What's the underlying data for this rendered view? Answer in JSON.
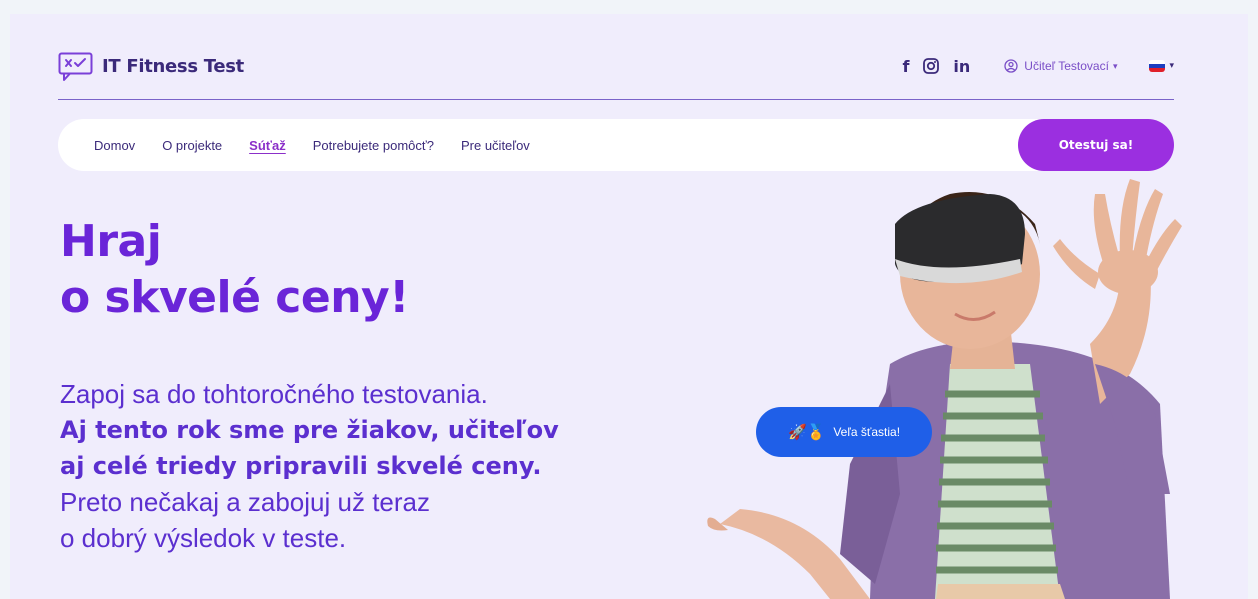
{
  "brand": {
    "name": "IT Fitness Test"
  },
  "social": [
    {
      "label": "f",
      "icon": "facebook-icon"
    },
    {
      "label": "◎",
      "icon": "instagram-icon"
    },
    {
      "label": "in",
      "icon": "linkedin-icon"
    }
  ],
  "user": {
    "name": "Učiteľ Testovací"
  },
  "language": {
    "flag": "slovak-flag-icon"
  },
  "nav": {
    "items": [
      {
        "label": "Domov"
      },
      {
        "label": "O projekte"
      },
      {
        "label": "Súťaž",
        "active": true
      },
      {
        "label": "Potrebujete pomôcť?"
      },
      {
        "label": "Pre učiteľov"
      }
    ],
    "cta_label": "Otestuj sa!"
  },
  "hero": {
    "title_line1": "Hraj",
    "title_line2": "o skvelé ceny!",
    "text_line1": "Zapoj sa do tohtoročného testovania.",
    "text_strong1": "Aj tento rok sme pre žiakov, učiteľov",
    "text_strong2": "aj celé triedy pripravili skvelé ceny.",
    "text_line4": "Preto nečakaj a zabojuj už teraz",
    "text_line5": "o dobrý výsledok v teste."
  },
  "badge": {
    "emoji": "🚀🏅",
    "label": "Veľa šťastia!"
  },
  "colors": {
    "accent": "#9b2fe0",
    "title": "#6a25d8",
    "badge": "#1f5fe8",
    "page_bg": "#f0edfc"
  }
}
